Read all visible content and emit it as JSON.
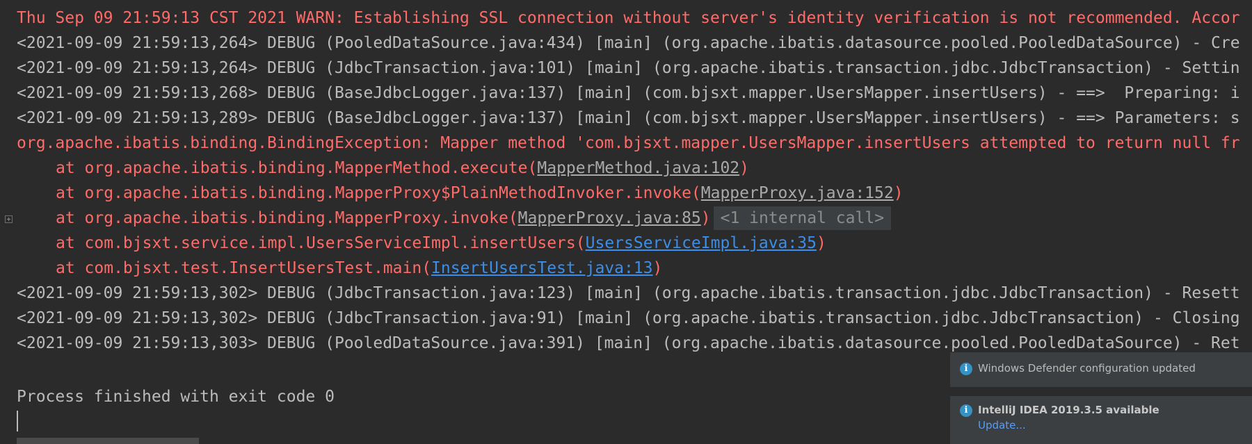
{
  "console": {
    "ssl_warning": "Thu Sep 09 21:59:13 CST 2021 WARN: Establishing SSL connection without server's identity verification is not recommended. Accor",
    "debug_lines_top": [
      "<2021-09-09 21:59:13,264> DEBUG (PooledDataSource.java:434) [main] (org.apache.ibatis.datasource.pooled.PooledDataSource) - Cre",
      "<2021-09-09 21:59:13,264> DEBUG (JdbcTransaction.java:101) [main] (org.apache.ibatis.transaction.jdbc.JdbcTransaction) - Settin",
      "<2021-09-09 21:59:13,268> DEBUG (BaseJdbcLogger.java:137) [main] (com.bjsxt.mapper.UsersMapper.insertUsers) - ==>  Preparing: i",
      "<2021-09-09 21:59:13,289> DEBUG (BaseJdbcLogger.java:137) [main] (com.bjsxt.mapper.UsersMapper.insertUsers) - ==> Parameters: s"
    ],
    "exception": "org.apache.ibatis.binding.BindingException: Mapper method 'com.bjsxt.mapper.UsersMapper.insertUsers attempted to return null fr",
    "stack": [
      {
        "prefix": "at org.apache.ibatis.binding.MapperMethod.execute(",
        "link": "MapperMethod.java:102",
        "suffix": ")"
      },
      {
        "prefix": "at org.apache.ibatis.binding.MapperProxy$PlainMethodInvoker.invoke(",
        "link": "MapperProxy.java:152",
        "suffix": ")"
      },
      {
        "prefix": "at org.apache.ibatis.binding.MapperProxy.invoke(",
        "link": "MapperProxy.java:85",
        "suffix": ")",
        "badge": "<1 internal call>"
      },
      {
        "prefix": "at com.bjsxt.service.impl.UsersServiceImpl.insertUsers(",
        "link": "UsersServiceImpl.java:35",
        "suffix": ")"
      },
      {
        "prefix": "at com.bjsxt.test.InsertUsersTest.main(",
        "link": "InsertUsersTest.java:13",
        "suffix": ")"
      }
    ],
    "debug_lines_bottom": [
      "<2021-09-09 21:59:13,302> DEBUG (JdbcTransaction.java:123) [main] (org.apache.ibatis.transaction.jdbc.JdbcTransaction) - Resett",
      "<2021-09-09 21:59:13,302> DEBUG (JdbcTransaction.java:91) [main] (org.apache.ibatis.transaction.jdbc.JdbcTransaction) - Closing",
      "<2021-09-09 21:59:13,303> DEBUG (PooledDataSource.java:391) [main] (org.apache.ibatis.datasource.pooled.PooledDataSource) - Ret"
    ],
    "process_finished": "Process finished with exit code 0"
  },
  "notifications": {
    "defender": {
      "icon": "info-icon",
      "text": "Windows Defender configuration updated"
    },
    "update": {
      "icon": "info-icon",
      "title": "IntelliJ IDEA 2019.3.5 available",
      "link": "Update..."
    }
  },
  "colors": {
    "background": "#2b2b2b",
    "error_text": "#ff6b68",
    "normal_text": "#bbbbbb",
    "link_blue": "#3b8eea",
    "link_gray": "#a9a9a9",
    "notification_bg": "#3c3f41",
    "info_icon": "#3592c4"
  }
}
